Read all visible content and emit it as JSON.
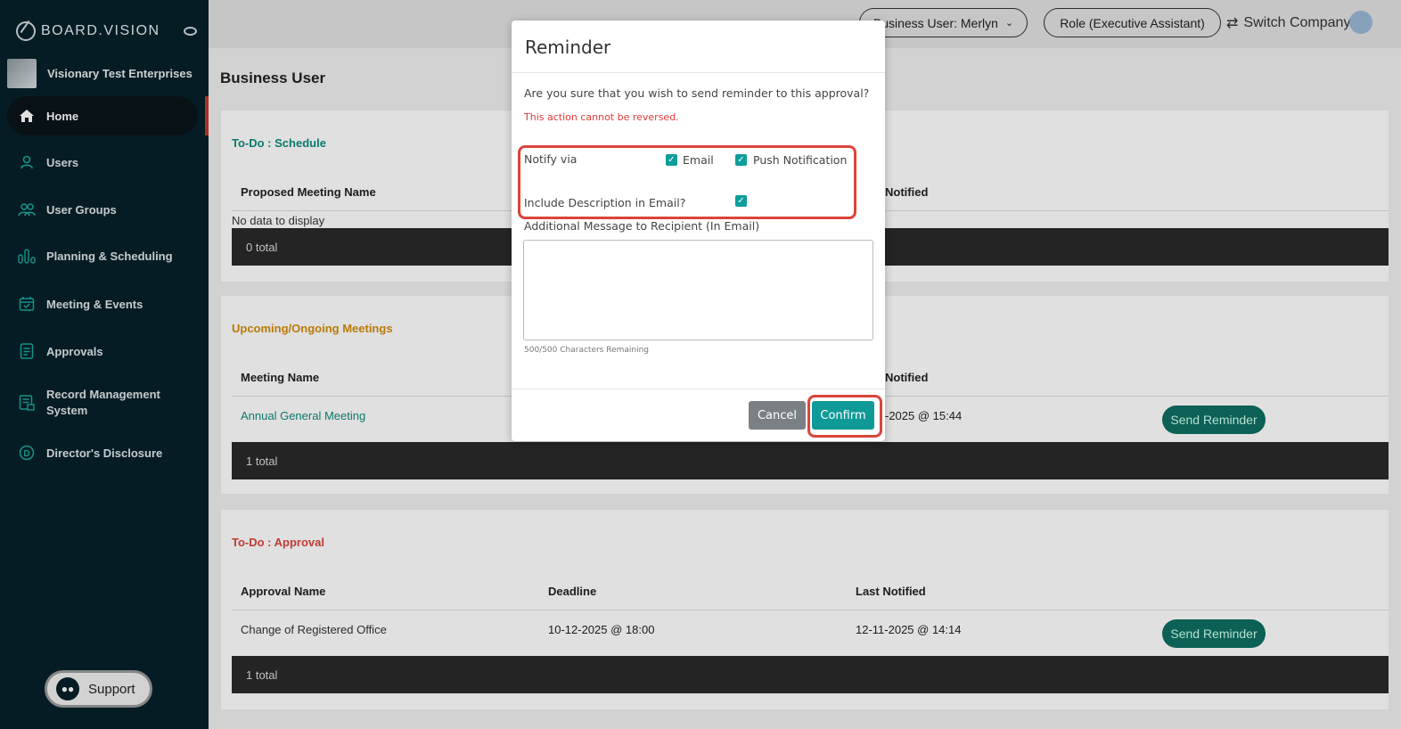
{
  "sidebar": {
    "logo": "BOARD.VISION",
    "company": "Visionary Test Enterprises",
    "items": [
      {
        "label": "Home",
        "icon": "home-icon"
      },
      {
        "label": "Users",
        "icon": "user-icon"
      },
      {
        "label": "User Groups",
        "icon": "users-icon"
      },
      {
        "label": "Planning & Scheduling",
        "icon": "bar-chart-icon"
      },
      {
        "label": "Meeting & Events",
        "icon": "calendar-icon"
      },
      {
        "label": "Approvals",
        "icon": "document-icon"
      },
      {
        "label": "Record Management System",
        "icon": "record-icon"
      },
      {
        "label": "Director's Disclosure",
        "icon": "disclosure-icon"
      }
    ],
    "support": "Support"
  },
  "topbar": {
    "business_user": "Business User: Merlyn",
    "role": "Role (Executive Assistant)",
    "switch_company": "Switch Company"
  },
  "page": {
    "title": "Business User"
  },
  "schedule": {
    "title": "To-Do : Schedule",
    "col1": "Proposed Meeting Name",
    "col_last": "Notified",
    "empty": "No data to display",
    "total": "0 total"
  },
  "meetings": {
    "title": "Upcoming/Ongoing Meetings",
    "col1": "Meeting Name",
    "col_last": "Notified",
    "row_name": "Annual General Meeting",
    "row_notified": "-2025 @ 15:44",
    "send": "Send Reminder",
    "total": "1 total"
  },
  "approval": {
    "title": "To-Do : Approval",
    "col1": "Approval Name",
    "col2": "Deadline",
    "col3": "Last Notified",
    "row_name": "Change of Registered Office",
    "row_deadline": "10-12-2025 @ 18:00",
    "row_notified": "12-11-2025 @ 14:14",
    "send": "Send Reminder",
    "total": "1 total"
  },
  "modal": {
    "title": "Reminder",
    "question": "Are you sure that you wish to send reminder to this approval?",
    "warning": "This action cannot be reversed.",
    "notify_via": "Notify via",
    "email": "Email",
    "push": "Push Notification",
    "include_desc": "Include Description in Email?",
    "additional_msg": "Additional Message to Recipient (In Email)",
    "char_count": "500/500 Characters Remaining",
    "cancel": "Cancel",
    "confirm": "Confirm"
  },
  "colors": {
    "sidebar_bg": "#07202b",
    "teal": "#0f9a98",
    "schedule_title": "#0e8a7e",
    "meetings_title": "#d38b0a",
    "approval_title": "#d9453b",
    "highlight": "#d9453b"
  }
}
